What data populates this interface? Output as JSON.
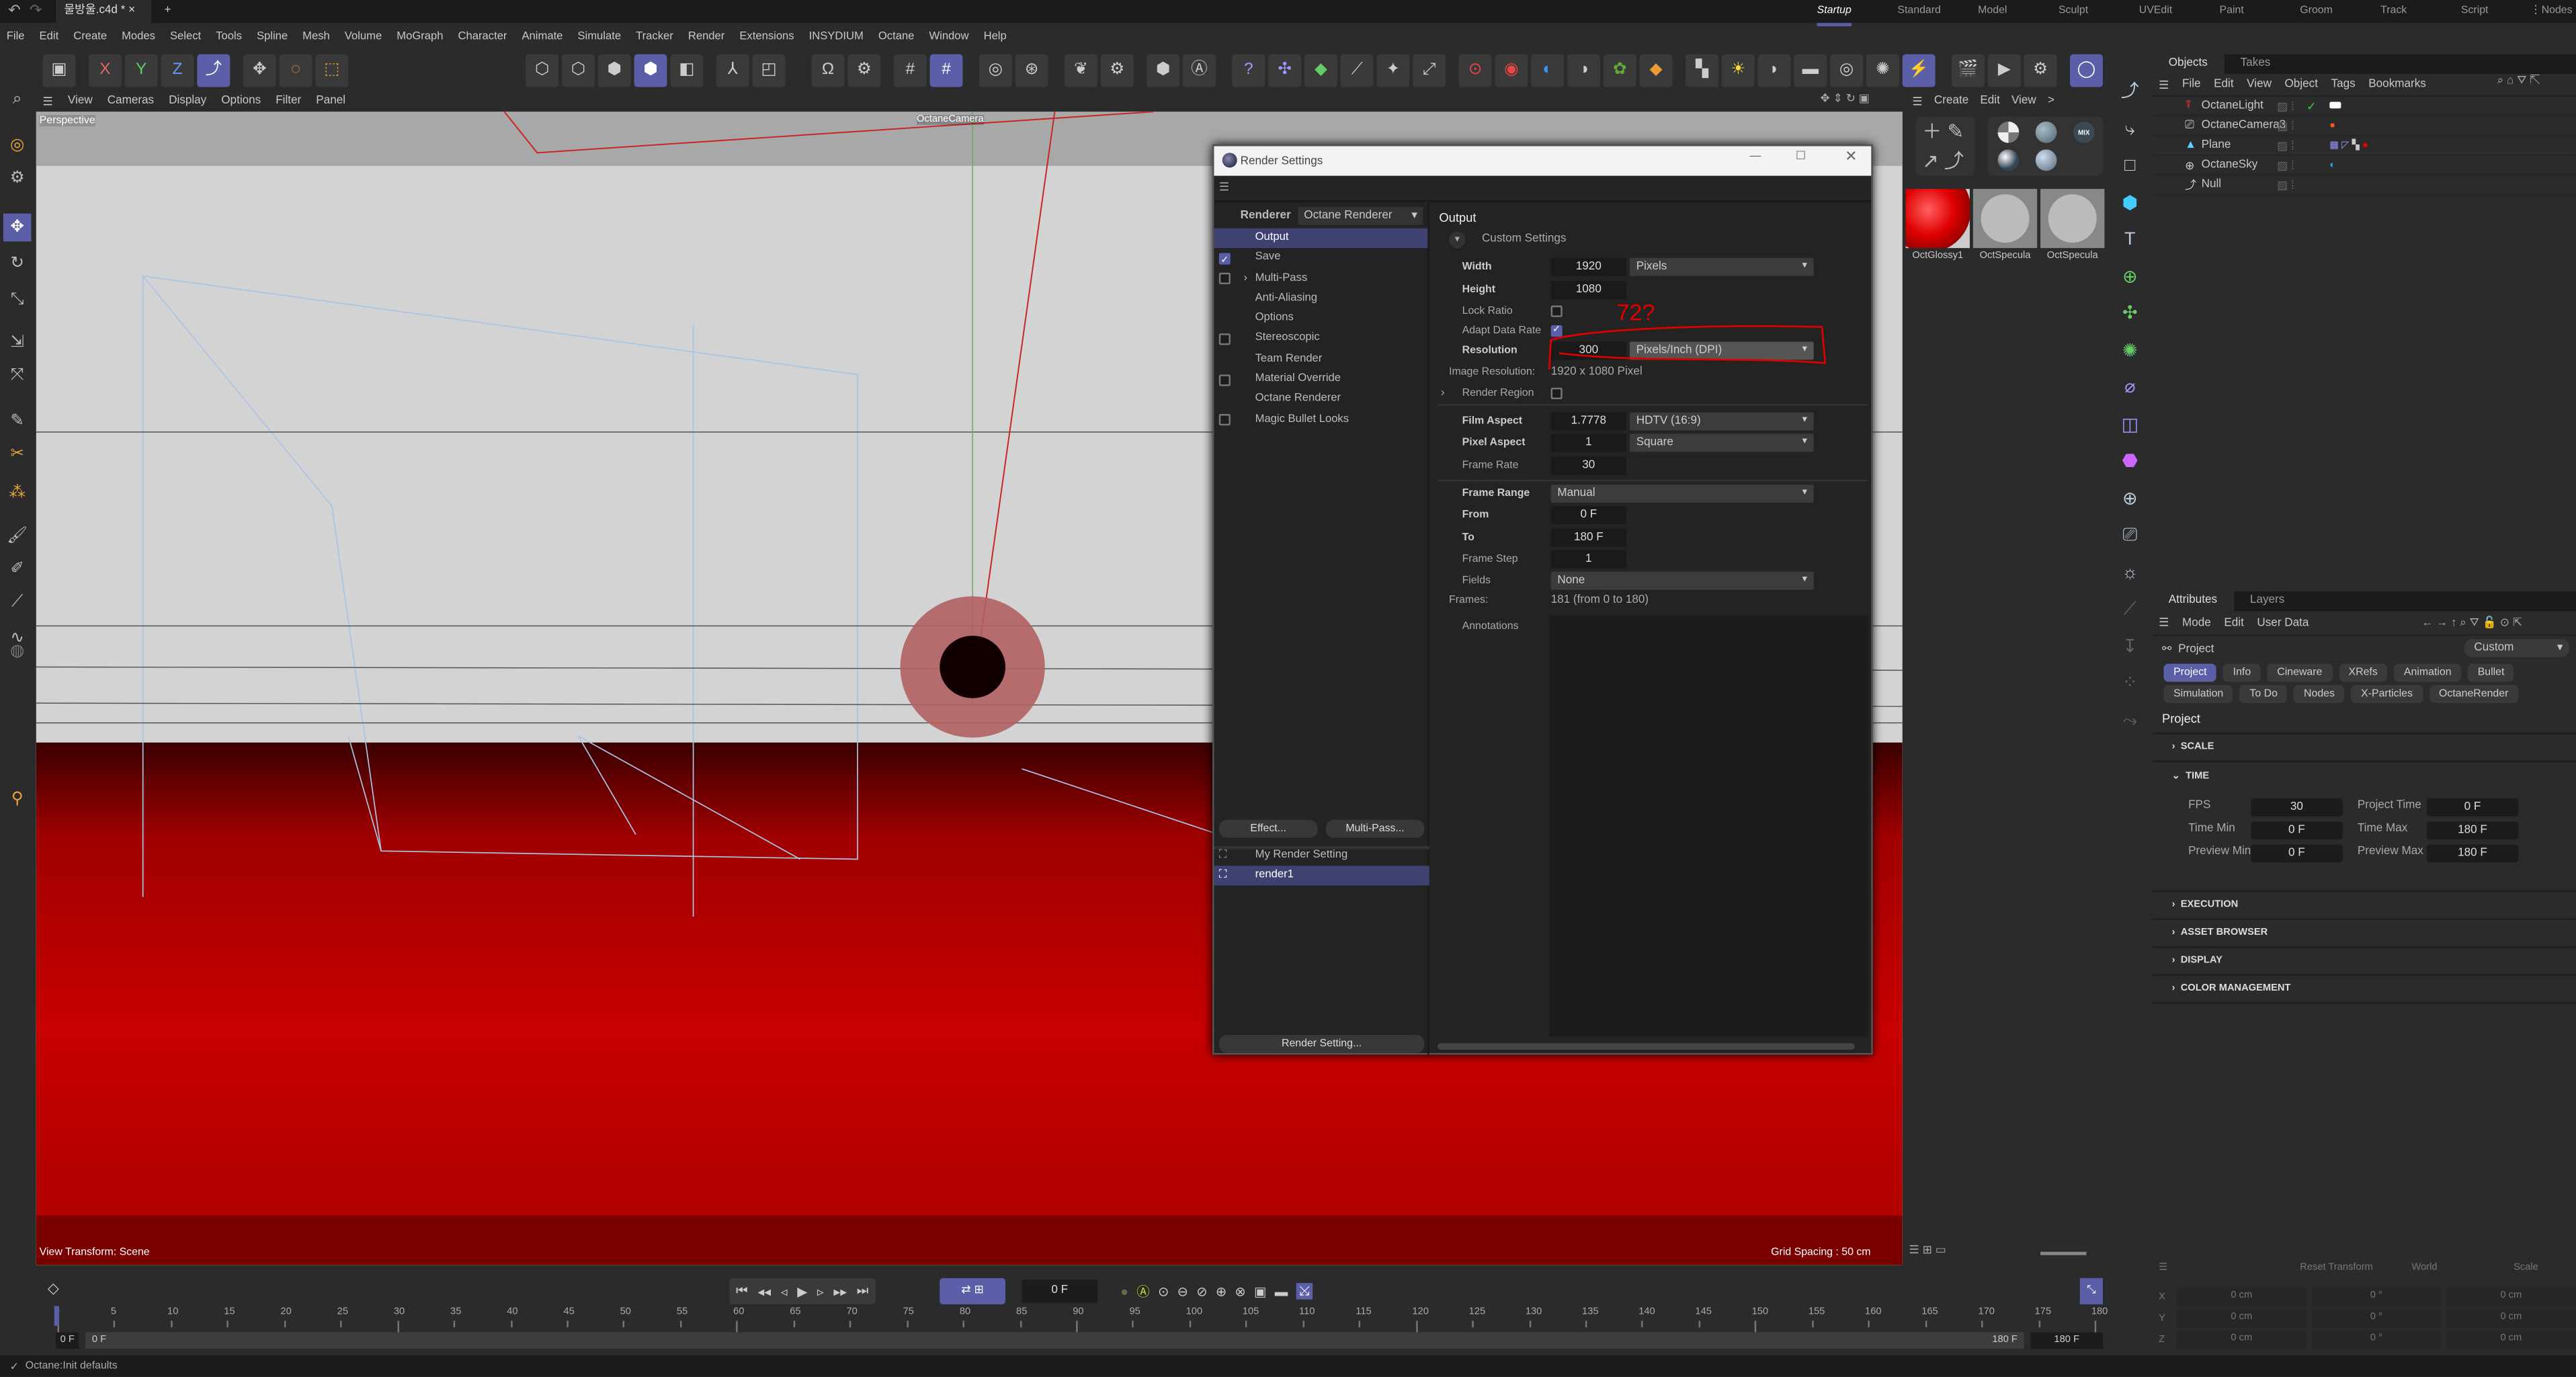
{
  "tabbar": {
    "document_tab": "물방울.c4d *",
    "new_tab": "+",
    "layouts": [
      {
        "label": "Startup",
        "active": true
      },
      {
        "label": "Standard"
      },
      {
        "label": "Model"
      },
      {
        "label": "Sculpt"
      },
      {
        "label": "UVEdit"
      },
      {
        "label": "Paint"
      },
      {
        "label": "Groom"
      },
      {
        "label": "Track"
      },
      {
        "label": "Script"
      },
      {
        "label": "Nodes"
      }
    ]
  },
  "menu": [
    "File",
    "Edit",
    "Create",
    "Modes",
    "Select",
    "Tools",
    "Spline",
    "Mesh",
    "Volume",
    "MoGraph",
    "Character",
    "Animate",
    "Simulate",
    "Tracker",
    "Render",
    "Extensions",
    "INSYDIUM",
    "Octane",
    "Window",
    "Help"
  ],
  "toolbar": {
    "axis": [
      "X",
      "Y",
      "Z"
    ]
  },
  "viewport": {
    "menu": [
      "View",
      "Cameras",
      "Display",
      "Options",
      "Filter",
      "Panel"
    ],
    "view_name": "Perspective",
    "camera_label": "OctaneCamera",
    "view_transform": "View Transform: Scene",
    "grid_spacing": "Grid Spacing : 50 cm"
  },
  "materials": {
    "menu": [
      "Create",
      "Edit",
      "View",
      ">"
    ],
    "mix_label": "MIX",
    "items": [
      "OctGlossy1",
      "OctSpecula",
      "OctSpecula"
    ]
  },
  "objects": {
    "tabs": [
      "Objects",
      "Takes"
    ],
    "menu": [
      "File",
      "Edit",
      "View",
      "Object",
      "Tags",
      "Bookmarks"
    ],
    "items": [
      {
        "name": "OctaneLight"
      },
      {
        "name": "OctaneCamera3"
      },
      {
        "name": "Plane"
      },
      {
        "name": "OctaneSky"
      },
      {
        "name": "Null"
      }
    ]
  },
  "attributes": {
    "tabs": [
      "Attributes",
      "Layers"
    ],
    "menu": [
      "Mode",
      "Edit",
      "User Data"
    ],
    "object": "Project",
    "preset": "Custom",
    "chips_row1": [
      "Project",
      "Info",
      "Cineware",
      "XRefs",
      "Animation",
      "Bullet"
    ],
    "chips_row2": [
      "Simulation",
      "To Do",
      "Nodes",
      "X-Particles",
      "OctaneRender"
    ],
    "heading": "Project",
    "sections": {
      "scale": "SCALE",
      "time": "TIME",
      "execution": "EXECUTION",
      "asset": "ASSET BROWSER",
      "display": "DISPLAY",
      "color": "COLOR MANAGEMENT"
    },
    "time": {
      "fps_label": "FPS",
      "fps": "30",
      "ptime_label": "Project Time",
      "ptime": "0 F",
      "tmin_label": "Time Min",
      "tmin": "0 F",
      "tmax_label": "Time Max",
      "tmax": "180 F",
      "pmin_label": "Preview Min",
      "pmin": "0 F",
      "pmax_label": "Preview Max",
      "pmax": "180 F"
    }
  },
  "coords": {
    "reset": "Reset Transform",
    "world": "World",
    "scale": "Scale",
    "rows": [
      {
        "axis": "X",
        "a": "0 cm",
        "b": "0 °",
        "c": "0 cm"
      },
      {
        "axis": "Y",
        "a": "0 cm",
        "b": "0 °",
        "c": "0 cm"
      },
      {
        "axis": "Z",
        "a": "0 cm",
        "b": "0 °",
        "c": "0 cm"
      }
    ]
  },
  "timeline": {
    "current_frame": "0 F",
    "ticks": [
      "0",
      "5",
      "10",
      "15",
      "20",
      "25",
      "30",
      "35",
      "40",
      "45",
      "50",
      "55",
      "60",
      "65",
      "70",
      "75",
      "80",
      "85",
      "90",
      "95",
      "100",
      "105",
      "110",
      "115",
      "120",
      "125",
      "130",
      "135",
      "140",
      "145",
      "150",
      "155",
      "160",
      "165",
      "170",
      "175",
      "180"
    ],
    "start": "0 F",
    "range_start": "0 F",
    "range_end": "180 F",
    "end": "180 F"
  },
  "status": "Octane:Init defaults",
  "dialog": {
    "title": "Render Settings",
    "renderer_label": "Renderer",
    "renderer": "Octane Renderer",
    "nav": [
      {
        "label": "Output",
        "selected": true
      },
      {
        "label": "Save",
        "checkbox": true,
        "checked": true
      },
      {
        "label": "Multi-Pass",
        "checkbox": true,
        "expand": true
      },
      {
        "label": "Anti-Aliasing"
      },
      {
        "label": "Options"
      },
      {
        "label": "Stereoscopic",
        "checkbox": true
      },
      {
        "label": "Team Render"
      },
      {
        "label": "Material Override",
        "checkbox": true
      },
      {
        "label": "Octane Renderer"
      },
      {
        "label": "Magic Bullet Looks",
        "checkbox": true
      }
    ],
    "effect_btn": "Effect...",
    "multipass_btn": "Multi-Pass...",
    "settings": [
      "My Render Setting",
      "render1"
    ],
    "render_setting_btn": "Render Setting...",
    "section": "Output",
    "custom": "Custom Settings",
    "width_label": "Width",
    "width": "1920",
    "width_unit": "Pixels",
    "height_label": "Height",
    "height": "1080",
    "lock_label": "Lock Ratio",
    "lock": false,
    "adapt_label": "Adapt Data Rate",
    "adapt": true,
    "res_label": "Resolution",
    "res": "300",
    "res_unit": "Pixels/Inch (DPI)",
    "imgres_label": "Image Resolution:",
    "imgres": "1920 x 1080 Pixel",
    "region_label": "Render Region",
    "film_label": "Film Aspect",
    "film": "1.7778",
    "film_preset": "HDTV (16:9)",
    "pixel_label": "Pixel Aspect",
    "pixel": "1",
    "pixel_preset": "Square",
    "rate_label": "Frame Rate",
    "rate": "30",
    "range_label": "Frame Range",
    "range": "Manual",
    "from_label": "From",
    "from": "0 F",
    "to_label": "To",
    "to": "180 F",
    "step_label": "Frame Step",
    "step": "1",
    "fields_label": "Fields",
    "fields": "None",
    "frames_label": "Frames:",
    "frames": "181 (from 0 to 180)",
    "annotations_label": "Annotations",
    "handwritten_note": "72?"
  }
}
